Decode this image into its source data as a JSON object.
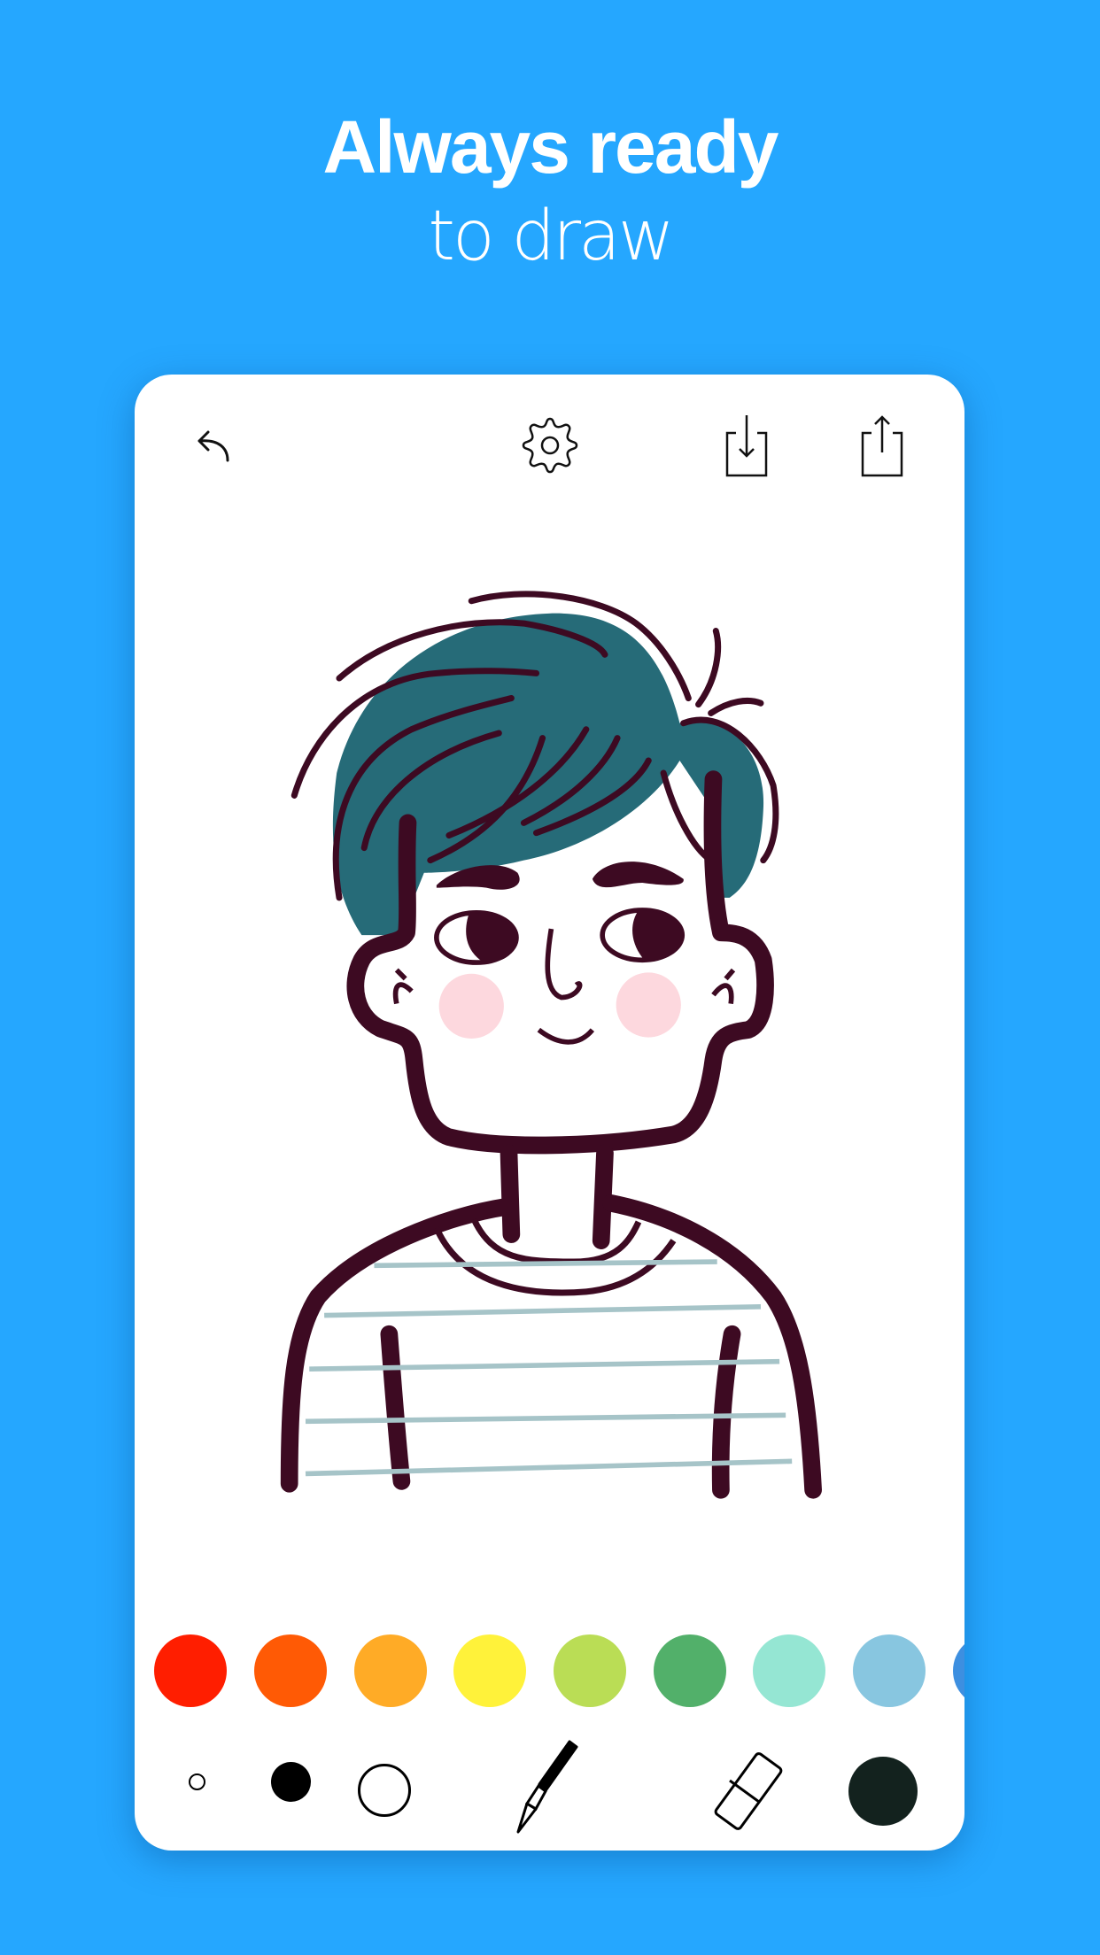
{
  "headline": {
    "title": "Always ready",
    "subtitle": "to draw"
  },
  "toolbar": {
    "icons": [
      "undo-icon",
      "settings-gear-icon",
      "save-download-icon",
      "share-icon"
    ]
  },
  "palette": {
    "colors": [
      "#ff1e00",
      "#ff5a05",
      "#ffab26",
      "#fff23a",
      "#badd55",
      "#52b06a",
      "#95e6d3",
      "#88c6e0",
      "#3d8fe0"
    ]
  },
  "tools": {
    "brush_sizes": [
      "small",
      "medium",
      "large"
    ],
    "pen": "pen-icon",
    "eraser": "eraser-icon",
    "selected_color": "#13221e"
  },
  "drawing": {
    "outline_color": "#3d0a22",
    "hair_color": "#266b78",
    "cheek_color": "#fdd8de",
    "stripe_color": "#a6c4c8"
  }
}
